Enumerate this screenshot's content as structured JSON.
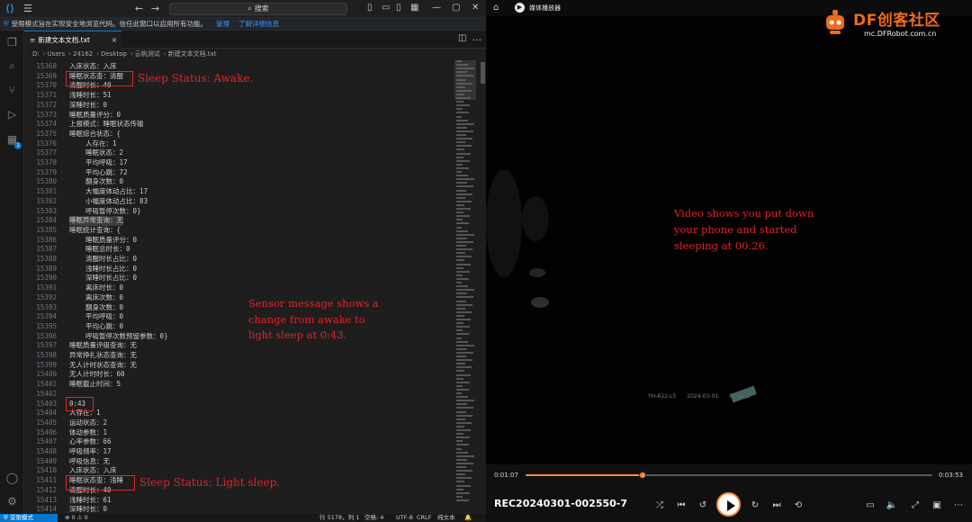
{
  "vscode": {
    "search_text": "搜索",
    "infobar": {
      "message": "受限模式旨在实现安全地浏览代码。信任此窗口以启用所有功能。",
      "manage_link": "管理",
      "learn_more_link": "了解详细信息"
    },
    "tab_label": "新建文本文档.txt",
    "breadcrumb": [
      "D:",
      "Users",
      "24162",
      "Desktop",
      "云帆测试",
      "新建文本文档.txt"
    ],
    "lines": [
      {
        "n": "15368",
        "text": "入床状态：入床"
      },
      {
        "n": "15369",
        "text": "睡眠状态查：清醒"
      },
      {
        "n": "15370",
        "text": "清醒时长：40"
      },
      {
        "n": "15371",
        "text": "浅睡时长：51"
      },
      {
        "n": "15372",
        "text": "深睡时长：0"
      },
      {
        "n": "15373",
        "text": "睡眠质量评分：0"
      },
      {
        "n": "15374",
        "text": "上报模式：睡眠状态传输"
      },
      {
        "n": "15375",
        "text": "睡眠综合状态：{"
      },
      {
        "n": "15376",
        "text": "    人存在：1"
      },
      {
        "n": "15377",
        "text": "    睡眠状态：2"
      },
      {
        "n": "15378",
        "text": "    平均呼吸：17"
      },
      {
        "n": "15379",
        "text": "    平均心跳：72"
      },
      {
        "n": "15380",
        "text": "    翻身次数：0"
      },
      {
        "n": "15381",
        "text": "    大幅度体动占比：17"
      },
      {
        "n": "15382",
        "text": "    小幅度体动占比：83"
      },
      {
        "n": "15383",
        "text": "    呼吸暂停次数：0}"
      },
      {
        "n": "15384",
        "text": "睡眠异常查询：无"
      },
      {
        "n": "15385",
        "text": "睡眠统计查询：{"
      },
      {
        "n": "15386",
        "text": "    睡眠质量评分：0"
      },
      {
        "n": "15387",
        "text": "    睡眠总时长：0"
      },
      {
        "n": "15388",
        "text": "    清醒时长占比：0"
      },
      {
        "n": "15389",
        "text": "    浅睡时长占比：0"
      },
      {
        "n": "15390",
        "text": "    深睡时长占比：0"
      },
      {
        "n": "15391",
        "text": "    离床时长：0"
      },
      {
        "n": "15392",
        "text": "    离床次数：0"
      },
      {
        "n": "15393",
        "text": "    翻身次数：0"
      },
      {
        "n": "15394",
        "text": "    平均呼吸：0"
      },
      {
        "n": "15395",
        "text": "    平均心跳：0"
      },
      {
        "n": "15396",
        "text": "    呼吸暂停次数预留参数：0}"
      },
      {
        "n": "15397",
        "text": "睡眠质量评级查询：无"
      },
      {
        "n": "15398",
        "text": "异常挣扎状态查询：无"
      },
      {
        "n": "15399",
        "text": "无人计时状态查询：无"
      },
      {
        "n": "15400",
        "text": "无人计时时长：60"
      },
      {
        "n": "15401",
        "text": "睡眠截止时间：5"
      },
      {
        "n": "15402",
        "text": ""
      },
      {
        "n": "15403",
        "text": "0:43"
      },
      {
        "n": "15404",
        "text": "人存在：1"
      },
      {
        "n": "15405",
        "text": "运动状态：2"
      },
      {
        "n": "15406",
        "text": "体动参数：1"
      },
      {
        "n": "15407",
        "text": "心率参数：66"
      },
      {
        "n": "15408",
        "text": "呼吸频率：17"
      },
      {
        "n": "15409",
        "text": "呼吸信息：无"
      },
      {
        "n": "15410",
        "text": "入床状态：入床"
      },
      {
        "n": "15411",
        "text": "睡眠状态查：浅睡"
      },
      {
        "n": "15412",
        "text": "清醒时长：40"
      },
      {
        "n": "15413",
        "text": "浅睡时长：61"
      },
      {
        "n": "15414",
        "text": "深睡时长：0"
      }
    ],
    "status": {
      "restricted": "受限模式",
      "errors": "0",
      "warnings": "0",
      "position": "行 5178，列 1",
      "spaces": "空格: 4",
      "encoding": "UTF-8",
      "eol": "CRLF",
      "language": "纯文本"
    }
  },
  "annotations": {
    "awake": "Sleep Status: Awake.",
    "sensor": "Sensor message shows a\nchange from awake to\nlight sleep at 0:43.",
    "light": "Sleep Status: Light sleep.",
    "video": "Video shows you put down\nyour phone and started\nsleeping at 00:26."
  },
  "player": {
    "app_name": "媒体播放器",
    "brand": "DF创客社区",
    "brand_url": "mc.DFRobot.com.cn",
    "osd": [
      "YH-A12-L5",
      "2024-03-01",
      "00:26:3"
    ],
    "current_time": "0:01:07",
    "duration": "0:03:53",
    "progress_fraction": 0.2876,
    "title": "REC20240301-002550-7",
    "accent": "#ff8a3d"
  }
}
